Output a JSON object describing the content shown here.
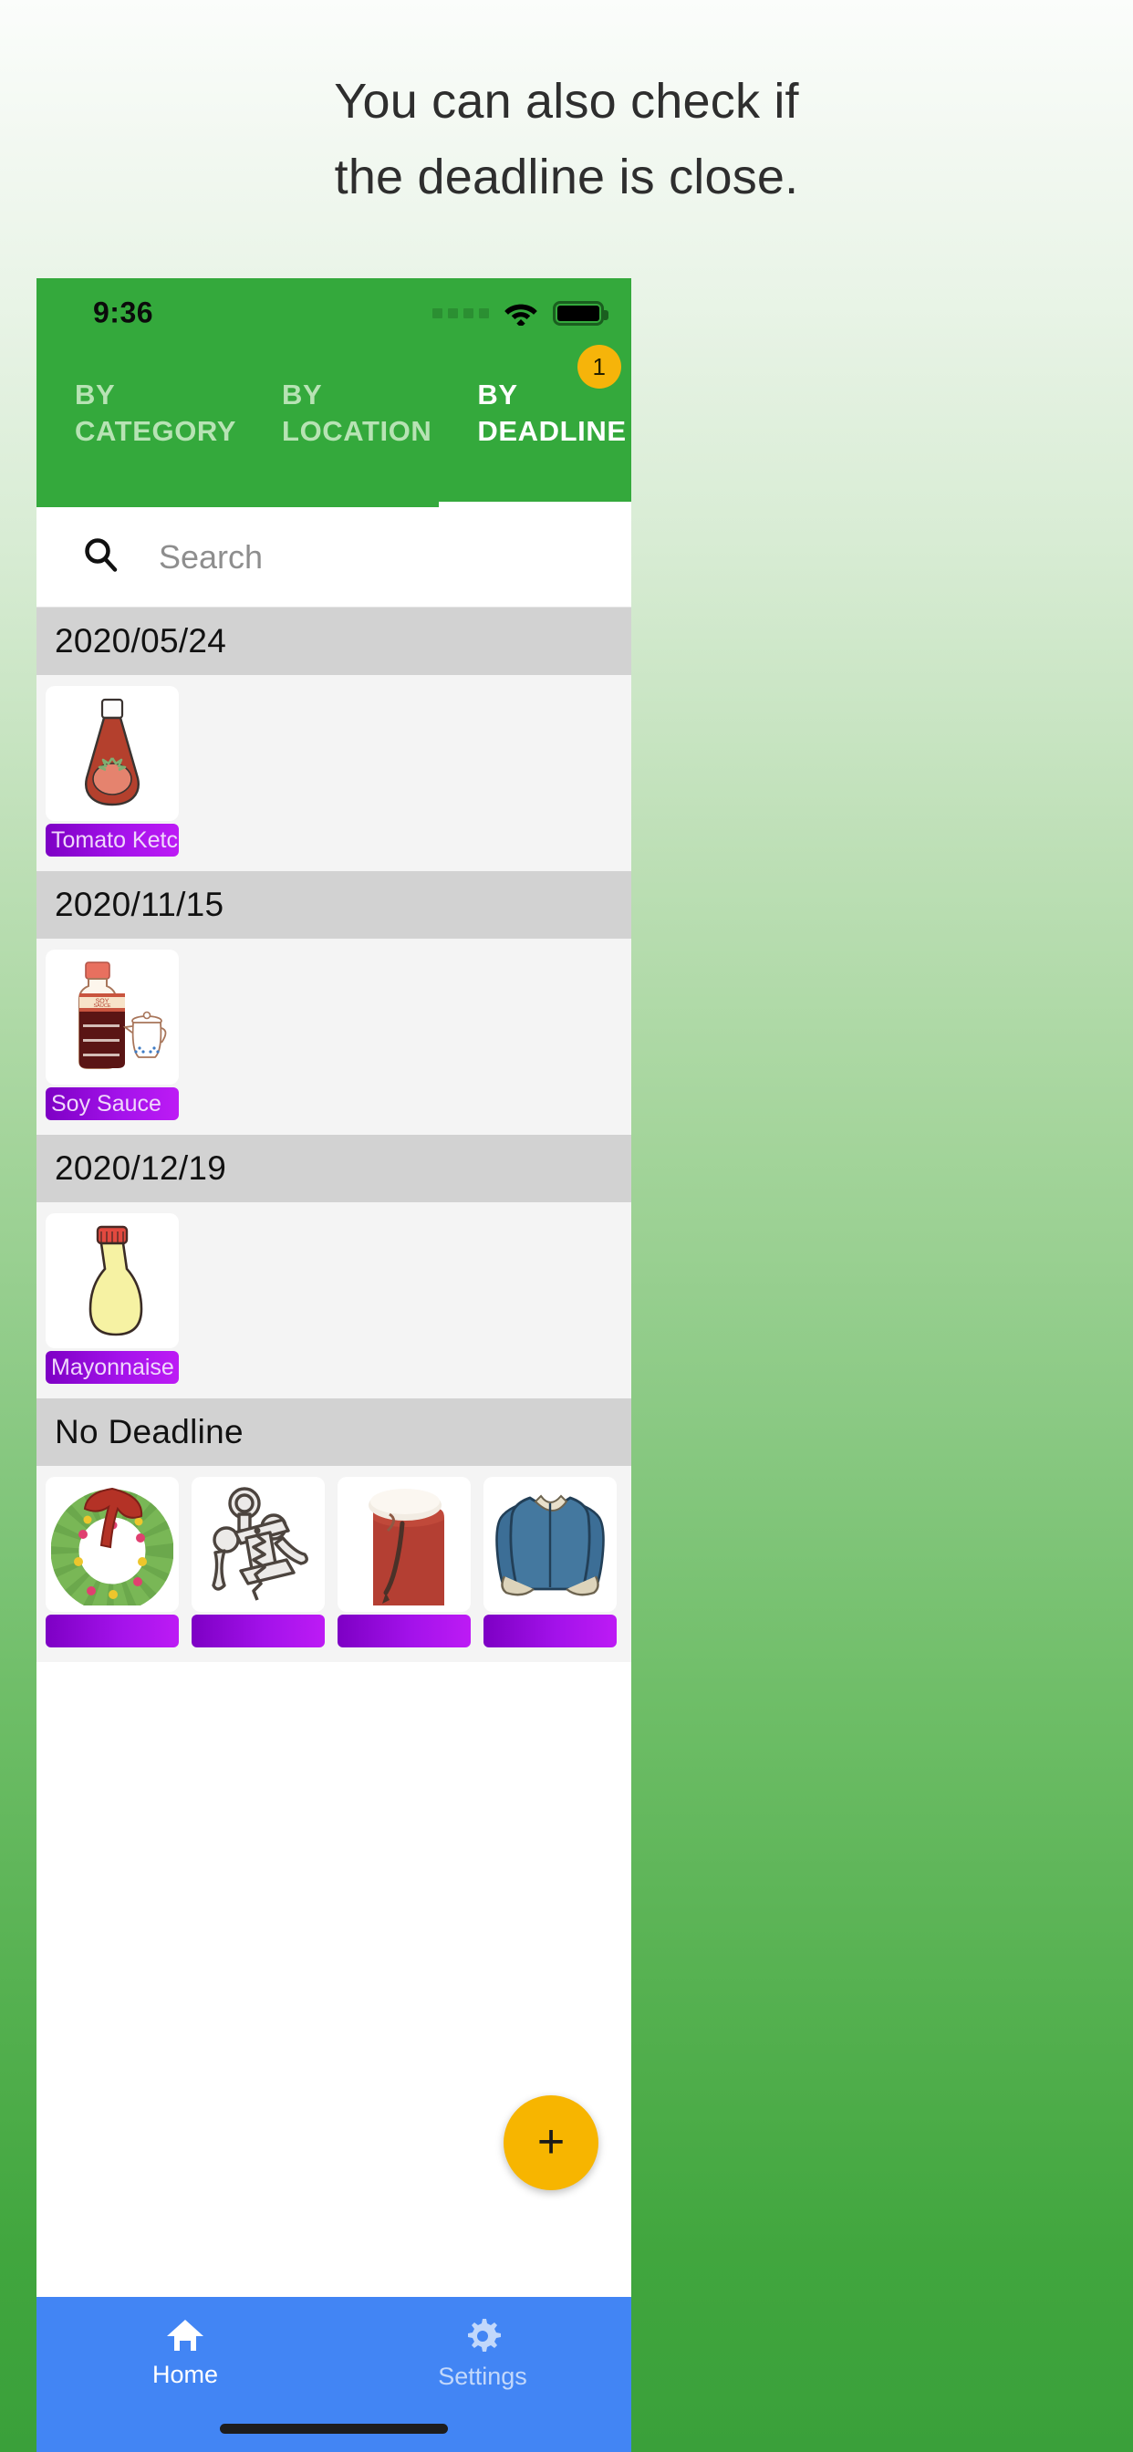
{
  "caption": {
    "line1": "You can also check if",
    "line2": "the deadline is close."
  },
  "statusbar": {
    "time": "9:36",
    "signal_icon": "signal-dots-icon",
    "wifi_icon": "wifi-icon",
    "battery_icon": "battery-full-icon"
  },
  "tabs": [
    {
      "label": "BY\nCATEGORY",
      "active": false
    },
    {
      "label": "BY\nLOCATION",
      "active": false
    },
    {
      "label": "BY\nDEADLINE",
      "active": true,
      "badge": "1"
    }
  ],
  "search": {
    "placeholder": "Search",
    "value": "",
    "icon": "search-icon"
  },
  "groups": [
    {
      "header": "2020/05/24",
      "items": [
        {
          "label": "Tomato  Ketchup",
          "display_label": "Tomato  Ketch",
          "image": "ketchup-bottle-image"
        }
      ]
    },
    {
      "header": "2020/11/15",
      "items": [
        {
          "label": "Soy  Sauce",
          "display_label": "Soy  Sauce",
          "image": "soy-sauce-bottle-image"
        }
      ]
    },
    {
      "header": "2020/12/19",
      "items": [
        {
          "label": "Mayonnaise",
          "display_label": "Mayonnaise",
          "image": "mayonnaise-bottle-image"
        }
      ]
    },
    {
      "header": "No Deadline",
      "items": [
        {
          "label": "",
          "display_label": "",
          "image": "christmas-wreath-image"
        },
        {
          "label": "",
          "display_label": "",
          "image": "corkscrew-image"
        },
        {
          "label": "",
          "display_label": "",
          "image": "christmas-stocking-image"
        },
        {
          "label": "",
          "display_label": "",
          "image": "jacket-image"
        }
      ]
    }
  ],
  "fab": {
    "label": "+",
    "icon": "plus-icon"
  },
  "bottomnav": [
    {
      "label": "Home",
      "icon": "home-icon",
      "active": true
    },
    {
      "label": "Settings",
      "icon": "gear-icon",
      "active": false
    }
  ],
  "colors": {
    "appbar_green": "#34a93c",
    "badge_orange": "#f6b40a",
    "label_purple": "#a312ea",
    "bottomnav_blue": "#4285f4",
    "group_header_gray": "#d2d2d2"
  }
}
